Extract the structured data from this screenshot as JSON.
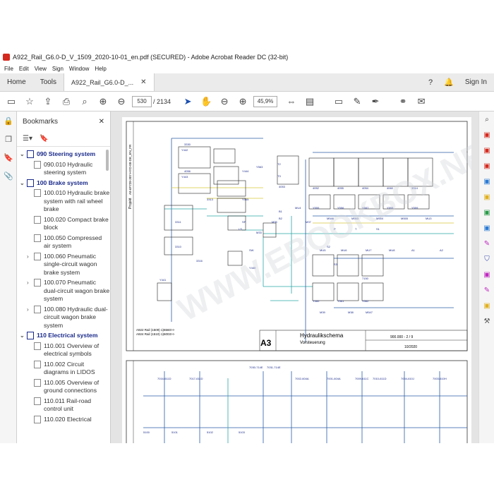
{
  "window": {
    "title": "A922_Rail_G6.0-D_V_1509_2020-10-01_en.pdf (SECURED) - Adobe Acrobat Reader DC (32-bit)"
  },
  "menu": [
    "File",
    "Edit",
    "View",
    "Sign",
    "Window",
    "Help"
  ],
  "tabs": {
    "home": "Home",
    "tools": "Tools",
    "document": "A922_Rail_G6.0-D_..."
  },
  "header": {
    "signin": "Sign In"
  },
  "toolbar": {
    "page_current": "530",
    "page_total": "/ 2134",
    "zoom": "45,9%"
  },
  "bookmarks": {
    "title": "Bookmarks",
    "items": [
      {
        "label": "090 Steering system",
        "level": 0
      },
      {
        "label": "090.010 Hydraulic steering system",
        "level": 1
      },
      {
        "label": "100 Brake system",
        "level": 0
      },
      {
        "label": "100.010 Hydraulic brake system with rail wheel brake",
        "level": 1
      },
      {
        "label": "100.020 Compact brake block",
        "level": 1
      },
      {
        "label": "100.050 Compressed air system",
        "level": 1
      },
      {
        "label": "100.060 Pneumatic single-circuit wagon brake system",
        "level": 1
      },
      {
        "label": "100.070 Pneumatic dual-circuit wagon brake system",
        "level": 1
      },
      {
        "label": "100.080 Hydraulic dual-circuit wagon brake system",
        "level": 1
      },
      {
        "label": "110 Electrical system",
        "level": 0
      },
      {
        "label": "110.001 Overview of electrical symbols",
        "level": 1
      },
      {
        "label": "110.002 Circuit diagrams in LIDOS",
        "level": 1
      },
      {
        "label": "110.005 Overview of ground connections",
        "level": 1
      },
      {
        "label": "110.011 Rail-road control unit",
        "level": 1
      },
      {
        "label": "110.020 Electrical",
        "level": 1
      }
    ]
  },
  "drawing": {
    "sheet_size": "A3",
    "title": "Hydraulikschema",
    "subtitle": "Vorsteuerung",
    "drawing_no": "900.000 - 2 / 9",
    "date": "10/2020",
    "projekt": "Projekt",
    "project_code": "A9-6F728-307-HYD-00-DE_EN_FR",
    "legend_1": "A922 Rail (1509) 1)6560>>",
    "legend_2": "A924 Rail (1510) 1)6003>>",
    "labels": [
      "3330",
      "4056",
      "3313",
      "3311",
      "3310",
      "3316",
      "4053",
      "4052",
      "4055",
      "4054",
      "4060",
      "3314",
      "7150",
      "Y440",
      "Y441",
      "Y442",
      "Y443",
      "Y444",
      "Y445",
      "Y555",
      "Y556",
      "Y557",
      "Y558",
      "Y559",
      "Y560",
      "Y561",
      "Y562",
      "Y563",
      "M35",
      "M33",
      "M37",
      "M39",
      "M38",
      "M547",
      "M546",
      "M553",
      "M554",
      "M555",
      "MU3",
      "MU4",
      "MU5",
      "MU6",
      "MU7",
      "MU8",
      "A1",
      "A2",
      "B1",
      "B2",
      "P",
      "T",
      "S1",
      "S2",
      "S3",
      "T2",
      "T3",
      "LS",
      "SP",
      "SW"
    ],
    "lower_labels": [
      "7016-611D",
      "7017-611D",
      "7030-714E",
      "7031-714E",
      "7002-604A",
      "7001-604A",
      "7009-611C",
      "7010-611D",
      "7004-610J",
      "7003-610H",
      "5100",
      "5101",
      "5102",
      "5103",
      "5104",
      "5105",
      "5106",
      "5107"
    ],
    "watermark": "WWW.EBOOKBOX.NET"
  },
  "colors": {
    "wire_blue": "#2a5ea8",
    "wire_cyan": "#2aa6a6",
    "wire_yellow": "#d6c73a",
    "bookmark_blue": "#1a2a8a",
    "acrobat_red": "#d4291e"
  }
}
